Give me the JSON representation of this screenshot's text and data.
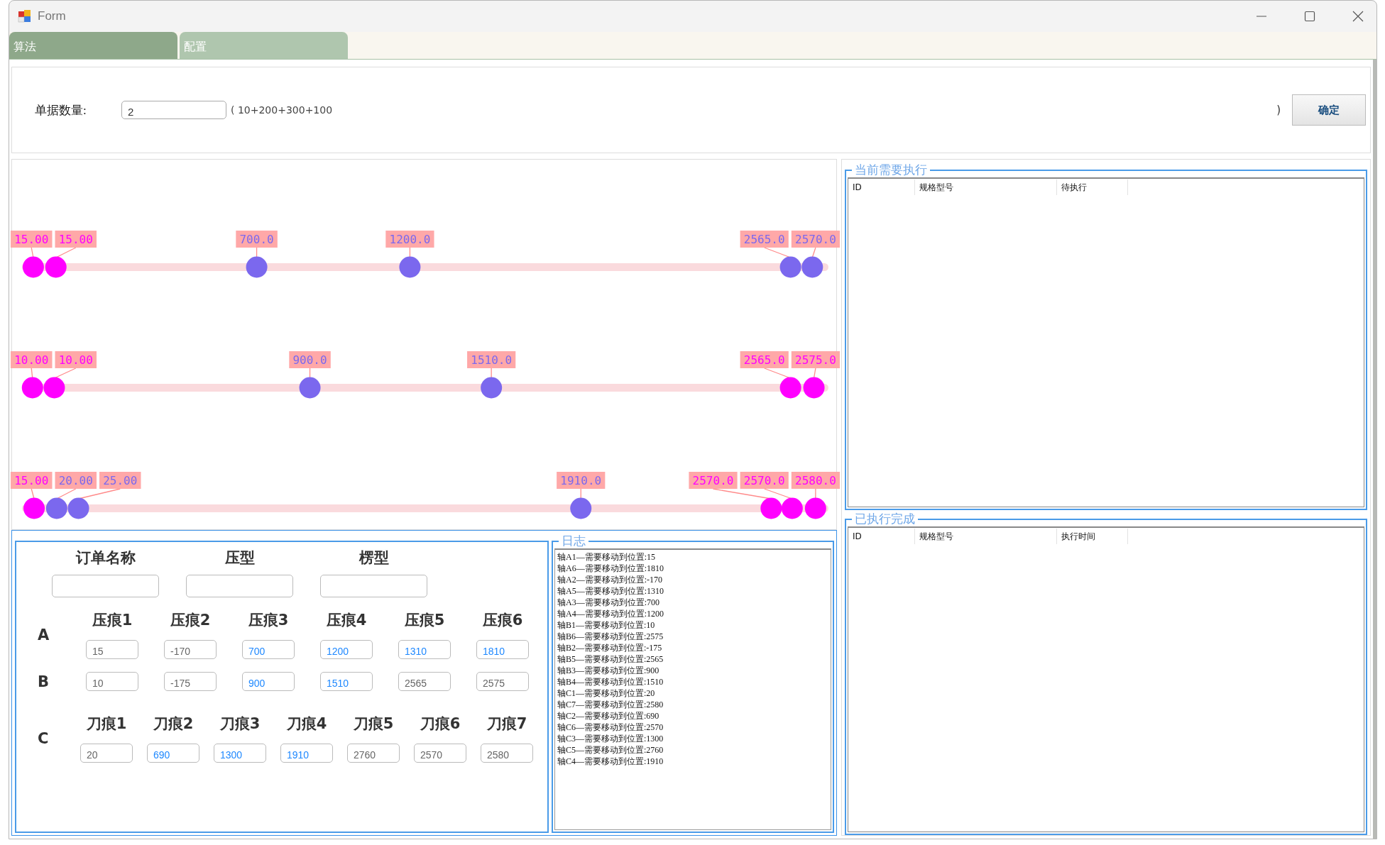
{
  "window": {
    "title": "Form"
  },
  "tabs": [
    {
      "label": "算法",
      "selected": true
    },
    {
      "label": "配置",
      "selected": false
    }
  ],
  "order_count": {
    "label": "单据数量:",
    "value": "2",
    "hint_open": "( 10+200+300+100",
    "hint_close": ")"
  },
  "confirm_button": "确定",
  "tracks": [
    {
      "markers": [
        {
          "label": "15.00",
          "level": 0.014,
          "color": "#ff00ff"
        },
        {
          "label": "15.00",
          "level": 0.042,
          "color": "#ff00ff"
        },
        {
          "label": "700.0",
          "level": 0.291,
          "color": "#7b68ee"
        },
        {
          "label": "1200.0",
          "level": 0.481,
          "color": "#7b68ee"
        },
        {
          "label": "2565.0",
          "level": 0.953,
          "color": "#7b68ee"
        },
        {
          "label": "2570.0",
          "level": 0.98,
          "color": "#7b68ee"
        }
      ]
    },
    {
      "markers": [
        {
          "label": "10.00",
          "level": 0.013,
          "color": "#ff00ff"
        },
        {
          "label": "10.00",
          "level": 0.04,
          "color": "#ff00ff"
        },
        {
          "label": "900.0",
          "level": 0.357,
          "color": "#7b68ee"
        },
        {
          "label": "1510.0",
          "level": 0.582,
          "color": "#7b68ee"
        },
        {
          "label": "2565.0",
          "level": 0.953,
          "color": "#ff00ff"
        },
        {
          "label": "2575.0",
          "level": 0.982,
          "color": "#ff00ff"
        }
      ]
    },
    {
      "markers": [
        {
          "label": "15.00",
          "level": 0.015,
          "color": "#ff00ff"
        },
        {
          "label": "20.00",
          "level": 0.043,
          "color": "#7b68ee"
        },
        {
          "label": "25.00",
          "level": 0.07,
          "color": "#7b68ee"
        },
        {
          "label": "1910.0",
          "level": 0.693,
          "color": "#7b68ee"
        },
        {
          "label": "2570.0",
          "level": 0.929,
          "color": "#ff00ff"
        },
        {
          "label": "2570.0",
          "level": 0.955,
          "color": "#ff00ff"
        },
        {
          "label": "2580.0",
          "level": 0.984,
          "color": "#ff00ff"
        }
      ]
    }
  ],
  "order_fields": [
    {
      "label": "订单名称"
    },
    {
      "label": "压型"
    },
    {
      "label": "楞型"
    }
  ],
  "axis_rows": [
    {
      "letter": "A",
      "fields": [
        {
          "label": "压痕1",
          "value": "15",
          "highlighted": false
        },
        {
          "label": "压痕2",
          "value": "-170",
          "highlighted": false
        },
        {
          "label": "压痕3",
          "value": "700",
          "highlighted": true
        },
        {
          "label": "压痕4",
          "value": "1200",
          "highlighted": true
        },
        {
          "label": "压痕5",
          "value": "1310",
          "highlighted": true
        },
        {
          "label": "压痕6",
          "value": "1810",
          "highlighted": true
        }
      ]
    },
    {
      "letter": "B",
      "fields": [
        {
          "value": "10",
          "highlighted": false
        },
        {
          "value": "-175",
          "highlighted": false
        },
        {
          "value": "900",
          "highlighted": true
        },
        {
          "value": "1510",
          "highlighted": true
        },
        {
          "value": "2565",
          "highlighted": false
        },
        {
          "value": "2575",
          "highlighted": false
        }
      ]
    },
    {
      "letter": "C",
      "fields": [
        {
          "label": "刀痕1",
          "value": "20",
          "highlighted": false
        },
        {
          "label": "刀痕2",
          "value": "690",
          "highlighted": true
        },
        {
          "label": "刀痕3",
          "value": "1300",
          "highlighted": true
        },
        {
          "label": "刀痕4",
          "value": "1910",
          "highlighted": true
        },
        {
          "label": "刀痕5",
          "value": "2760",
          "highlighted": false
        },
        {
          "label": "刀痕6",
          "value": "2570",
          "highlighted": false
        },
        {
          "label": "刀痕7",
          "value": "2580",
          "highlighted": false
        }
      ]
    }
  ],
  "log": {
    "title": "日志",
    "lines": [
      "轴A1—需要移动到位置:15",
      "轴A6—需要移动到位置:1810",
      "轴A2—需要移动到位置:-170",
      "轴A5—需要移动到位置:1310",
      "轴A3—需要移动到位置:700",
      "轴A4—需要移动到位置:1200",
      "轴B1—需要移动到位置:10",
      "轴B6—需要移动到位置:2575",
      "轴B2—需要移动到位置:-175",
      "轴B5—需要移动到位置:2565",
      "轴B3—需要移动到位置:900",
      "轴B4—需要移动到位置:1510",
      "轴C1—需要移动到位置:20",
      "轴C7—需要移动到位置:2580",
      "轴C2—需要移动到位置:690",
      "轴C6—需要移动到位置:2570",
      "轴C3—需要移动到位置:1300",
      "轴C5—需要移动到位置:2760",
      "轴C4—需要移动到位置:1910"
    ]
  },
  "pending": {
    "title": "当前需要执行",
    "columns": [
      "ID",
      "规格型号",
      "待执行"
    ]
  },
  "done": {
    "title": "已执行完成",
    "columns": [
      "ID",
      "规格型号",
      "执行时间"
    ]
  }
}
